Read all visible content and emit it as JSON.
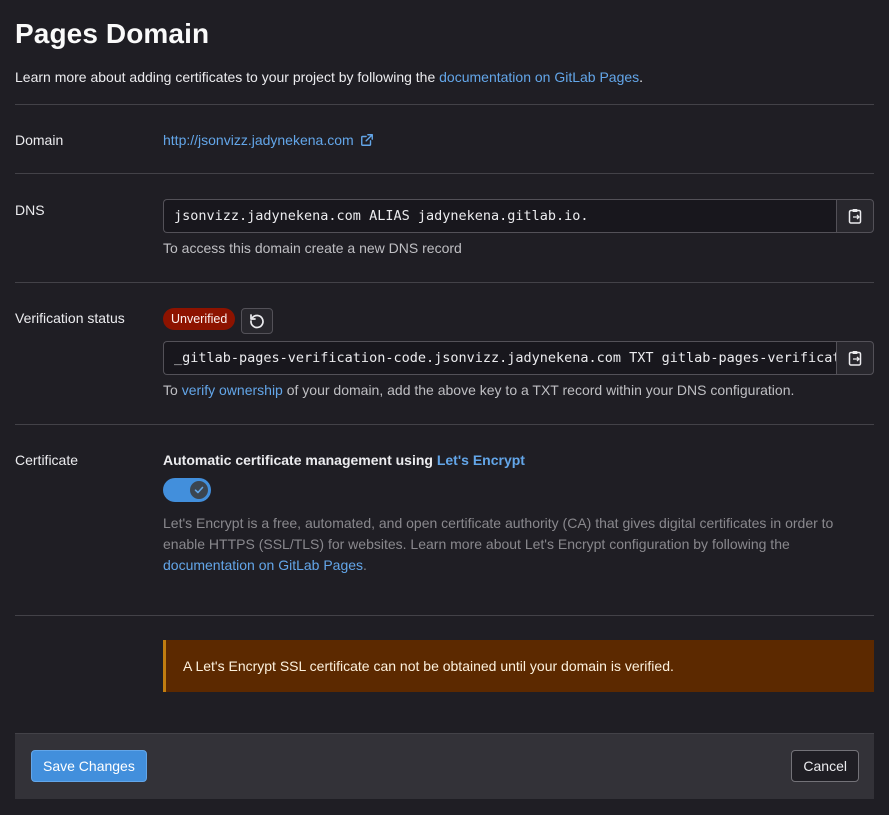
{
  "page": {
    "title": "Pages Domain",
    "intro_prefix": "Learn more about adding certificates to your project by following the ",
    "intro_link": "documentation on GitLab Pages",
    "intro_suffix": "."
  },
  "domain": {
    "label": "Domain",
    "url": "http://jsonvizz.jadynekena.com"
  },
  "dns": {
    "label": "DNS",
    "record": "jsonvizz.jadynekena.com ALIAS jadynekena.gitlab.io.",
    "help": "To access this domain create a new DNS record"
  },
  "verification": {
    "label": "Verification status",
    "status": "Unverified",
    "status_color": "#8d1300",
    "record": "_gitlab-pages-verification-code.jsonvizz.jadynekena.com TXT gitlab-pages-verification-code=",
    "help_prefix": "To ",
    "help_link": "verify ownership",
    "help_suffix": " of your domain, add the above key to a TXT record within your DNS configuration."
  },
  "certificate": {
    "label": "Certificate",
    "heading_prefix": "Automatic certificate management using ",
    "heading_link": "Let's Encrypt",
    "toggle_on": true,
    "desc": "Let's Encrypt is a free, automated, and open certificate authority (CA) that gives digital certificates in order to enable HTTPS (SSL/TLS) for websites. Learn more about Let's Encrypt configuration by following the ",
    "desc_link": "documentation on GitLab Pages",
    "desc_suffix": "."
  },
  "alert": {
    "text": "A Let's Encrypt SSL certificate can not be obtained until your domain is verified."
  },
  "footer": {
    "save_label": "Save Changes",
    "cancel_label": "Cancel"
  },
  "colors": {
    "accent": "#428fdc",
    "link": "#63a6e9",
    "warning_bg": "#5c2900"
  }
}
